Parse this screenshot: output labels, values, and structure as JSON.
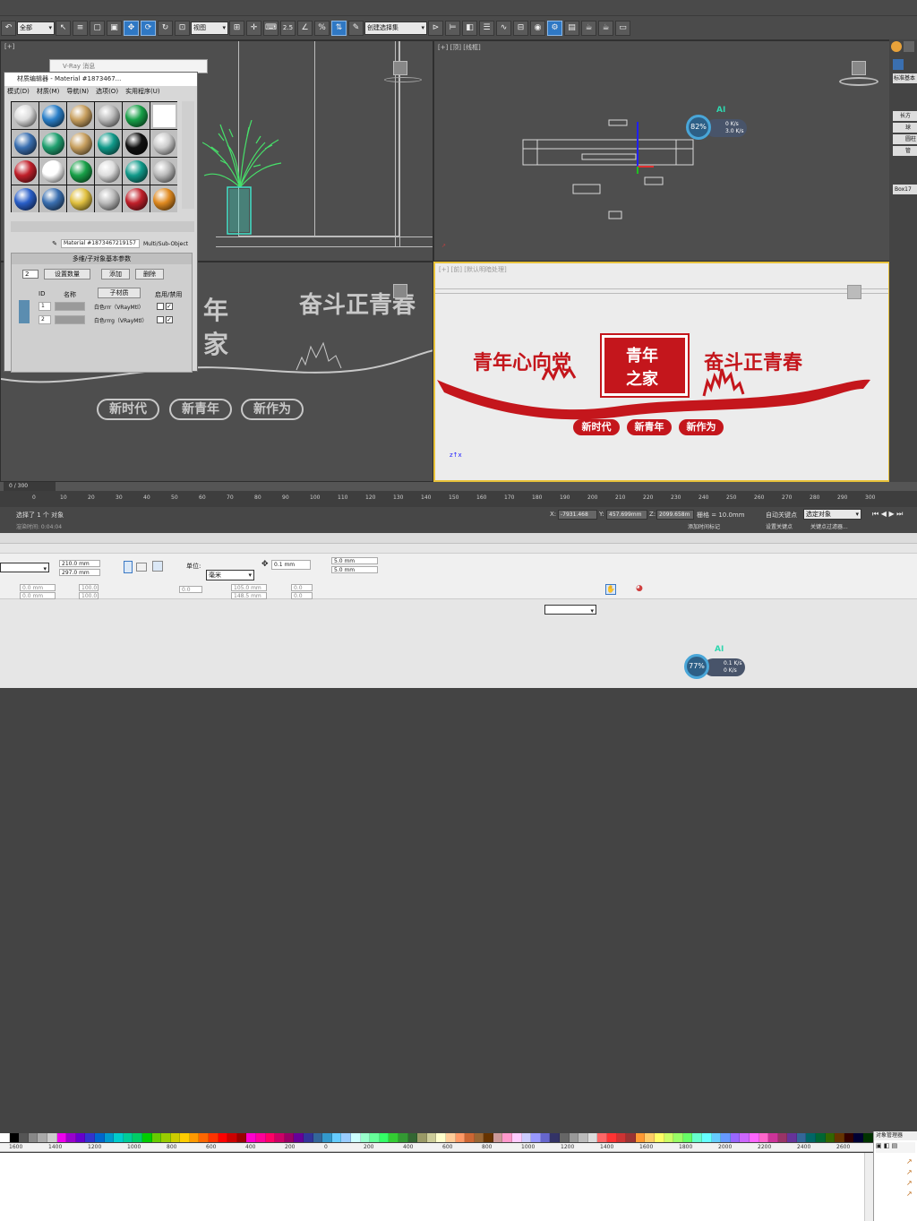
{
  "max": {
    "selection_filter": "全部",
    "view_dropdown": "视图",
    "named_selection": "创建选择集",
    "snap_value": "2.5",
    "viewports": {
      "top_right_label": "[+] [顶] [线框]",
      "bottom_right_label": "[+] [前] [默认明暗处理]"
    },
    "vray_window": {
      "title": "V-Ray 消息"
    },
    "material_editor": {
      "title": "材质编辑器 - Material #1873467...",
      "menu": [
        "模式(D)",
        "材质(M)",
        "导航(N)",
        "选项(O)",
        "实用程序(U)"
      ],
      "material_name": "Material #1873467219157",
      "material_type": "Multi/Sub-Object",
      "rollout_title": "多维/子对象基本参数",
      "count": "2",
      "set_count_label": "设置数量",
      "add_label": "添加",
      "delete_label": "删除",
      "col_id": "ID",
      "col_name": "名称",
      "col_sub": "子材质",
      "col_enable": "启用/禁用",
      "rows": [
        {
          "id": "1",
          "sub": "白色rrr（VRayMtl）"
        },
        {
          "id": "2",
          "sub": "白色rrrg（VRayMtl）"
        }
      ]
    },
    "design": {
      "left_slogan": "青年心向党",
      "center_top": "青年",
      "center_bottom": "之家",
      "right_slogan": "奋斗正青春",
      "pills": [
        "新时代",
        "新青年",
        "新作为"
      ],
      "wire_pills": [
        "新时代",
        "新青年",
        "新作为"
      ],
      "wire_slogan": "奋斗正青春",
      "wire_chars": [
        "年",
        "家"
      ]
    },
    "command_panel": {
      "label1": "标准基本",
      "items": [
        "长方",
        "球",
        "圆柱",
        "管"
      ],
      "object_name": "Box17"
    },
    "timeline": {
      "frame": "0 / 300",
      "ticks": [
        "0",
        "10",
        "20",
        "30",
        "40",
        "50",
        "60",
        "70",
        "80",
        "90",
        "100",
        "110",
        "120",
        "130",
        "140",
        "150",
        "160",
        "170",
        "180",
        "190",
        "200",
        "210",
        "220",
        "230",
        "240",
        "250",
        "260",
        "270",
        "280",
        "290",
        "300"
      ]
    },
    "status": {
      "msg1": "选择了 1 个 对象",
      "msg2": "渲染时间: 0:04:04",
      "x_label": "X:",
      "x_val": "-7931.468",
      "y_label": "Y:",
      "y_val": "457.699mm",
      "z_label": "Z:",
      "z_val": "2099.658m",
      "grid": "栅格 = 10.0mm",
      "auto_key": "自动关键点",
      "sel_obj": "选定对象",
      "set_key": "设置关键点",
      "key_filter": "关键点过滤器...",
      "add_time": "添加时间标记"
    }
  },
  "cdr": {
    "width": "210.0 mm",
    "height": "297.0 mm",
    "unit_label": "单位:",
    "unit": "毫米",
    "nudge": "0.1 mm",
    "dup_x": "5.0 mm",
    "dup_y": "5.0 mm",
    "pos_x": "0.0 mm",
    "pos_y": "0.0 mm",
    "scale_x": "100.0",
    "scale_y": "100.0",
    "angle": "0.0",
    "size_w": "105.0 mm",
    "size_h": "148.5 mm",
    "val1": "0.0",
    "val2": "0.0",
    "docker_title": "对象管理器",
    "ruler": [
      "1600",
      "1400",
      "1200",
      "1000",
      "800",
      "600",
      "400",
      "200",
      "0",
      "200",
      "400",
      "600",
      "800",
      "1000",
      "1200",
      "1400",
      "1600",
      "1800",
      "2000",
      "2200",
      "2400",
      "2600"
    ]
  },
  "badges": [
    {
      "pct": "82%",
      "up": "0 K/s",
      "down": "3.0 K/s",
      "ai": "AI"
    },
    {
      "pct": "77%",
      "up": "0.1 K/s",
      "down": "0 K/s",
      "ai": "AI"
    }
  ],
  "colors": {
    "accent_red": "#c4161c",
    "selection_blue": "#2f78c4",
    "viewport_gray": "#4e4e4e",
    "wire_white": "#c8c8c8",
    "plant_green": "#47e06a",
    "vase_cyan": "#40e0c8"
  }
}
